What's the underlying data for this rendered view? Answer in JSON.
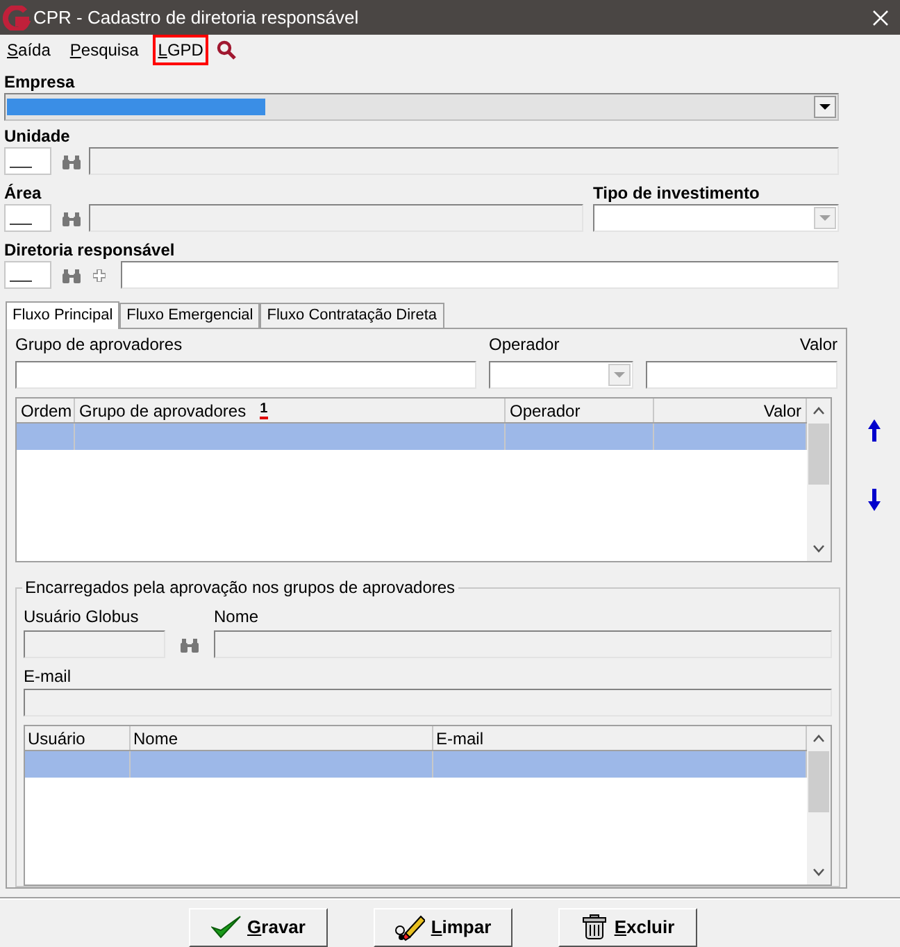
{
  "window": {
    "title": "CPR - Cadastro de diretoria responsável"
  },
  "menu": [
    {
      "label": "Saída",
      "highlighted": false
    },
    {
      "label": "Pesquisa",
      "highlighted": false
    },
    {
      "label": "LGPD",
      "highlighted": true
    }
  ],
  "empresa": {
    "label": "Empresa",
    "value_selected": true
  },
  "unidade": {
    "label": "Unidade"
  },
  "area": {
    "label": "Área"
  },
  "tipo_investimento": {
    "label": "Tipo de investimento"
  },
  "diretoria": {
    "label": "Diretoria responsável"
  },
  "tabs": [
    {
      "label": "Fluxo Principal",
      "selected": true
    },
    {
      "label": "Fluxo Emergencial",
      "selected": false
    },
    {
      "label": "Fluxo Contratação Direta",
      "selected": false
    }
  ],
  "filters": {
    "grupo": "Grupo de aprovadores",
    "operador": "Operador",
    "valor": "Valor"
  },
  "grid": {
    "columns": [
      {
        "label": "Ordem",
        "kind": "text"
      },
      {
        "label": "Grupo de aprovadores",
        "kind": "text",
        "sort": "1"
      },
      {
        "label": "Operador",
        "kind": "text"
      },
      {
        "label": "Valor",
        "kind": "number"
      }
    ],
    "rows": [
      {
        "selected": true
      }
    ]
  },
  "encarregados": {
    "title": "Encarregados pela aprovação nos grupos de aprovadores",
    "usuario_label": "Usuário Globus",
    "nome_label": "Nome",
    "email_label": "E-mail",
    "columns": [
      "Usuário",
      "Nome",
      "E-mail"
    ],
    "rows": [
      {
        "selected": true
      }
    ]
  },
  "buttons": [
    {
      "label": "Gravar",
      "kind": "save"
    },
    {
      "label": "Limpar",
      "kind": "clear"
    },
    {
      "label": "Excluir",
      "kind": "delete"
    }
  ]
}
